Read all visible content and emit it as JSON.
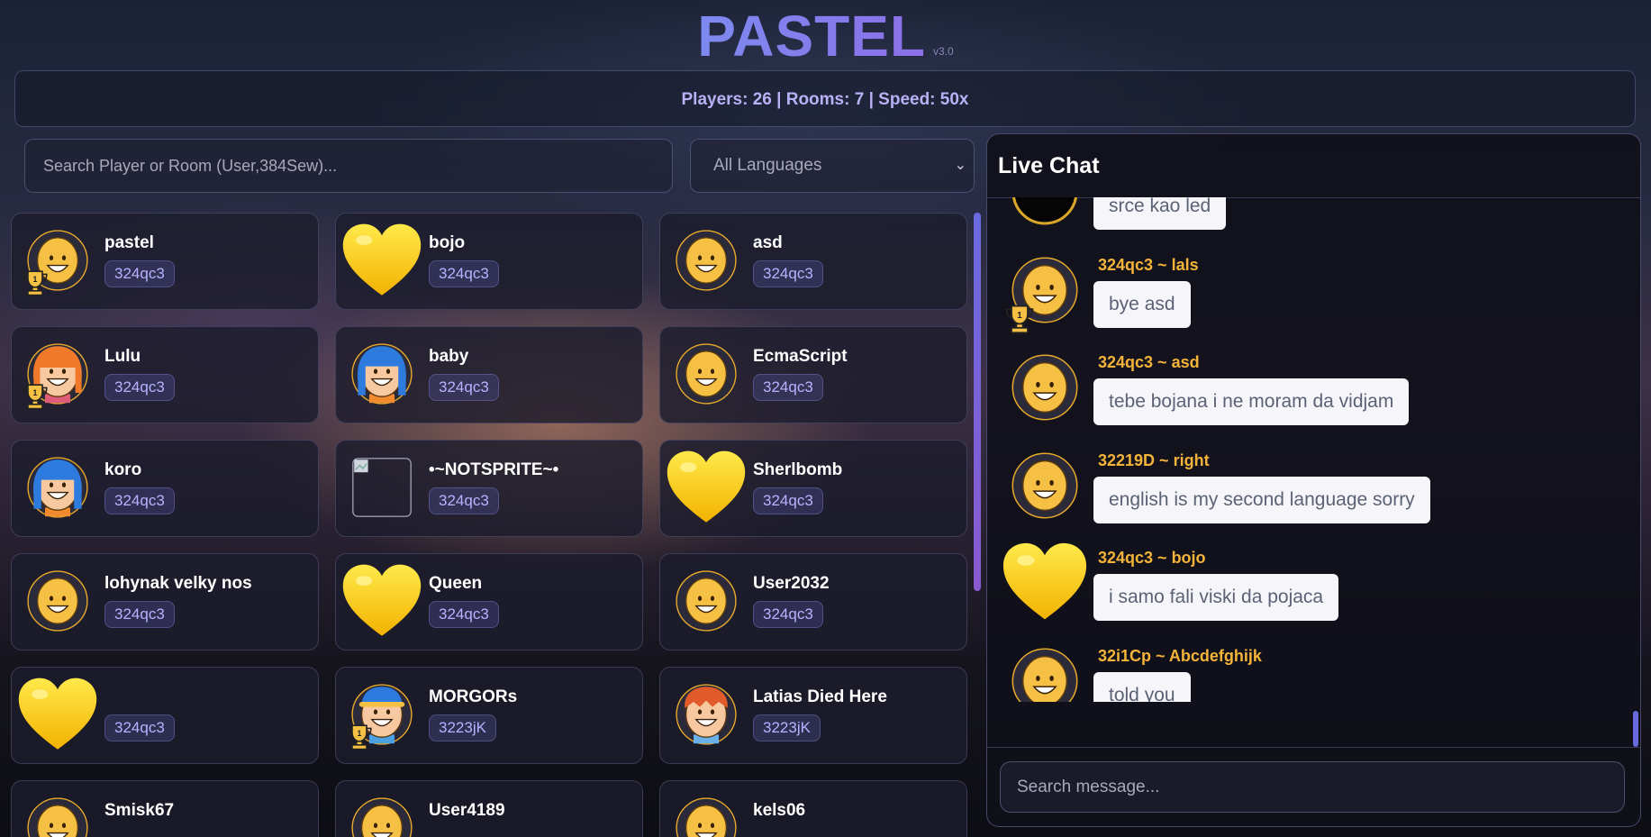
{
  "app": {
    "title": "PASTEL",
    "version": "v3.0"
  },
  "stats": {
    "text": "Players: 26 | Rooms: 7 | Speed: 50x"
  },
  "search": {
    "placeholder": "Search Player or Room (User,384Sew)..."
  },
  "language_filter": {
    "selected": "All Languages"
  },
  "colors": {
    "accent": "#7d8af0",
    "author": "#f4b43a",
    "room_tag": "#b8b2ff",
    "bubble": "#f6f6fa"
  },
  "players": [
    {
      "name": "pastel",
      "room": "324qc3",
      "avatar": "smiley",
      "trophy": true
    },
    {
      "name": "bojo",
      "room": "324qc3",
      "avatar": "heart",
      "trophy": false
    },
    {
      "name": "asd",
      "room": "324qc3",
      "avatar": "smiley",
      "trophy": false
    },
    {
      "name": "Lulu",
      "room": "324qc3",
      "avatar": "girl-orange",
      "trophy": true
    },
    {
      "name": "baby",
      "room": "324qc3",
      "avatar": "girl-blue",
      "trophy": false
    },
    {
      "name": "EcmaScript",
      "room": "324qc3",
      "avatar": "smiley",
      "trophy": false
    },
    {
      "name": "koro",
      "room": "324qc3",
      "avatar": "girl-blue",
      "trophy": false
    },
    {
      "name": "•~NOTSPRITE~•",
      "room": "324qc3",
      "avatar": "broken-image",
      "trophy": false
    },
    {
      "name": "Sherlbomb",
      "room": "324qc3",
      "avatar": "heart",
      "trophy": false
    },
    {
      "name": "lohynak velky nos",
      "room": "324qc3",
      "avatar": "smiley",
      "trophy": false
    },
    {
      "name": "Queen",
      "room": "324qc3",
      "avatar": "heart",
      "trophy": false
    },
    {
      "name": "User2032",
      "room": "324qc3",
      "avatar": "smiley",
      "trophy": false
    },
    {
      "name": "",
      "room": "324qc3",
      "avatar": "heart",
      "trophy": false
    },
    {
      "name": "MORGORs",
      "room": "3223jK",
      "avatar": "boy-cap",
      "trophy": true
    },
    {
      "name": "Latias Died Here",
      "room": "3223jK",
      "avatar": "boy-red",
      "trophy": false
    },
    {
      "name": "Smisk67",
      "room": "",
      "avatar": "smiley",
      "trophy": false
    },
    {
      "name": "User4189",
      "room": "",
      "avatar": "smiley",
      "trophy": false
    },
    {
      "name": "kels06",
      "room": "",
      "avatar": "smiley",
      "trophy": false
    }
  ],
  "chat": {
    "title": "Live Chat",
    "input_placeholder": "Search message...",
    "messages": [
      {
        "author": "",
        "text": "srce kao led",
        "avatar": "black-circle",
        "trophy": false
      },
      {
        "author": "324qc3 ~ lals",
        "text": "bye asd",
        "avatar": "smiley",
        "trophy": true
      },
      {
        "author": "324qc3 ~ asd",
        "text": "tebe bojana i ne moram da vidjam",
        "avatar": "smiley",
        "trophy": false
      },
      {
        "author": "32219D ~ right",
        "text": "english is my second language sorry",
        "avatar": "smiley",
        "trophy": false
      },
      {
        "author": "324qc3 ~ bojo",
        "text": "i samo fali viski da pojaca",
        "avatar": "heart",
        "trophy": false
      },
      {
        "author": "32i1Cp ~ Abcdefghijk",
        "text": "told you",
        "avatar": "smiley",
        "trophy": false
      }
    ]
  }
}
